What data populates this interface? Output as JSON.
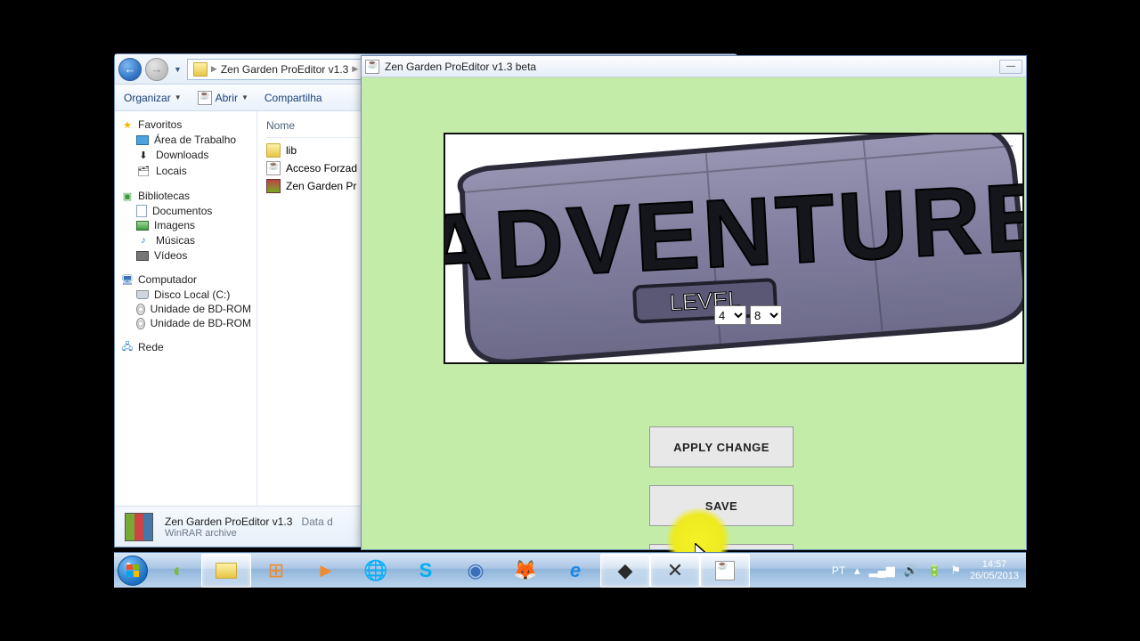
{
  "explorer": {
    "breadcrumb": "Zen Garden ProEditor v1.3",
    "toolbar": {
      "organize": "Organizar",
      "open": "Abrir",
      "share": "Compartilha"
    },
    "nav": {
      "favorites": "Favoritos",
      "desktop": "Área de Trabalho",
      "downloads": "Downloads",
      "locals": "Locais",
      "libraries": "Bibliotecas",
      "documents": "Documentos",
      "images": "Imagens",
      "music": "Músicas",
      "videos": "Vídeos",
      "computer": "Computador",
      "localdisk": "Disco Local (C:)",
      "bdrom1": "Unidade de BD-ROM",
      "bdrom2": "Unidade de BD-ROM",
      "network": "Rede"
    },
    "files": {
      "col_name": "Nome",
      "lib": "lib",
      "acceso": "Acceso Forzad",
      "zen": "Zen Garden Pr"
    },
    "details": {
      "name": "Zen Garden ProEditor v1.3",
      "kind_label": "Data d",
      "kind": "WinRAR archive"
    }
  },
  "app": {
    "title": "Zen Garden ProEditor v1.3 beta",
    "banner_word": "ADVENTURE",
    "level_label": "LEVEL",
    "level_a": "4",
    "level_b": "8",
    "apply": "APPLY CHANGE",
    "save": "SAVE"
  },
  "tray": {
    "lang": "PT",
    "time": "14:57",
    "date": "26/05/2013"
  }
}
